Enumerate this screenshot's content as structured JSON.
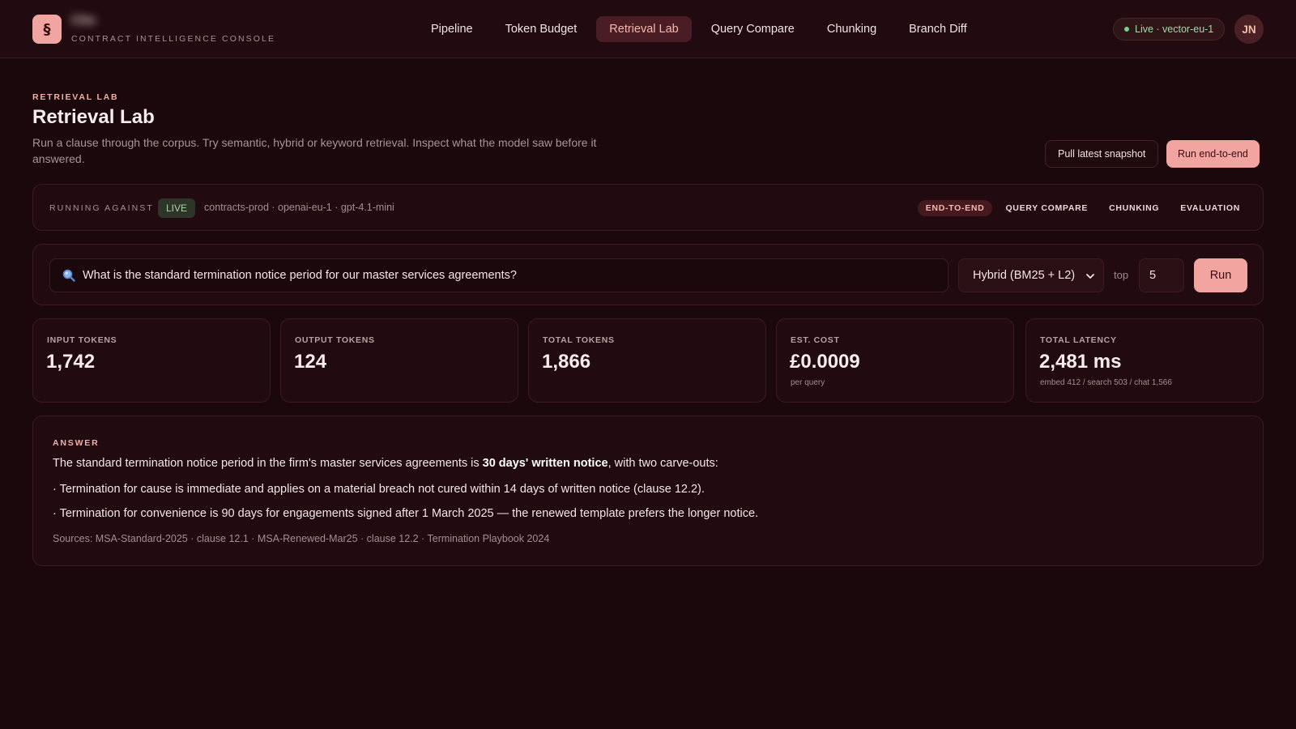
{
  "app": {
    "logo_glyph": "§",
    "name": "Clio",
    "subtitle": "CONTRACT INTELLIGENCE CONSOLE",
    "accent_color": "#f2a5a0"
  },
  "nav": {
    "items": [
      {
        "label": "Pipeline",
        "active": false
      },
      {
        "label": "Token Budget",
        "active": false
      },
      {
        "label": "Retrieval Lab",
        "active": true
      },
      {
        "label": "Query Compare",
        "active": false
      },
      {
        "label": "Chunking",
        "active": false
      },
      {
        "label": "Branch Diff",
        "active": false
      }
    ]
  },
  "env": {
    "status_label": "Live · vector-eu-1",
    "status_color": "#73d38a"
  },
  "user": {
    "initials": "JN"
  },
  "page": {
    "eyebrow": "RETRIEVAL LAB",
    "title": "Retrieval Lab",
    "description": "Run a clause through the corpus. Try semantic, hybrid or keyword retrieval. Inspect what the model saw before it answered.",
    "actions": {
      "pull_snapshot": "Pull latest snapshot",
      "run_e2e": "Run end-to-end"
    }
  },
  "context": {
    "label": "RUNNING AGAINST",
    "badge": "LIVE",
    "details": "contracts-prod · openai-eu-1 · gpt-4.1-mini",
    "tabs": [
      {
        "label": "END-TO-END",
        "active": true
      },
      {
        "label": "QUERY COMPARE",
        "active": false
      },
      {
        "label": "CHUNKING",
        "active": false
      },
      {
        "label": "EVALUATION",
        "active": false
      }
    ]
  },
  "query": {
    "icon": "search-icon",
    "text": "What is the standard termination notice period for our master services agreements?",
    "mode": "Hybrid (BM25 + L2)",
    "top_label": "top",
    "top_k": "5",
    "run_label": "Run"
  },
  "metrics": [
    {
      "label": "INPUT TOKENS",
      "value": "1,742",
      "sub": ""
    },
    {
      "label": "OUTPUT TOKENS",
      "value": "124",
      "sub": ""
    },
    {
      "label": "TOTAL TOKENS",
      "value": "1,866",
      "sub": ""
    },
    {
      "label": "EST. COST",
      "value": "£0.0009",
      "sub": "per query"
    },
    {
      "label": "TOTAL LATENCY",
      "value": "2,481 ms",
      "sub": "embed 412 / search 503 / chat 1,566"
    }
  ],
  "answer": {
    "label": "ANSWER",
    "intro_before": "The standard termination notice period in the firm's master services agreements is ",
    "intro_bold": "30 days' written notice",
    "intro_after": ", with two carve-outs:",
    "bullets": [
      "· Termination for cause is immediate and applies on a material breach not cured within 14 days of written notice (clause 12.2).",
      "· Termination for convenience is 90 days for engagements signed after 1 March 2025 — the renewed template prefers the longer notice."
    ],
    "sources": "Sources: MSA-Standard-2025 · clause 12.1 · MSA-Renewed-Mar25 · clause 12.2 · Termination Playbook 2024"
  }
}
